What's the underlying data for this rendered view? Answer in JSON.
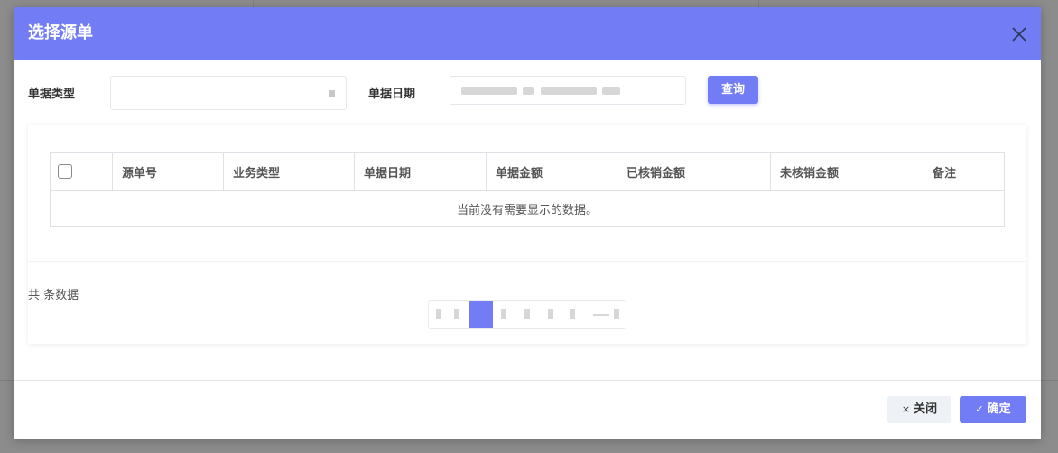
{
  "modal": {
    "title": "选择源单",
    "close_icon": "close-icon"
  },
  "filters": {
    "doc_type_label": "单据类型",
    "doc_date_label": "单据日期",
    "query_label": "查询"
  },
  "table": {
    "columns": [
      "源单号",
      "业务类型",
      "单据日期",
      "单据金额",
      "已核销金额",
      "未核销金额",
      "备注"
    ],
    "empty_text": "当前没有需要显示的数据。"
  },
  "pagination": {
    "total_text": "共 条数据"
  },
  "footer": {
    "close_label": "关闭",
    "close_icon_char": "×",
    "ok_label": "确定",
    "ok_icon_char": "✓"
  },
  "colors": {
    "accent": "#727cf5",
    "backdrop": "#8c8c8c"
  }
}
